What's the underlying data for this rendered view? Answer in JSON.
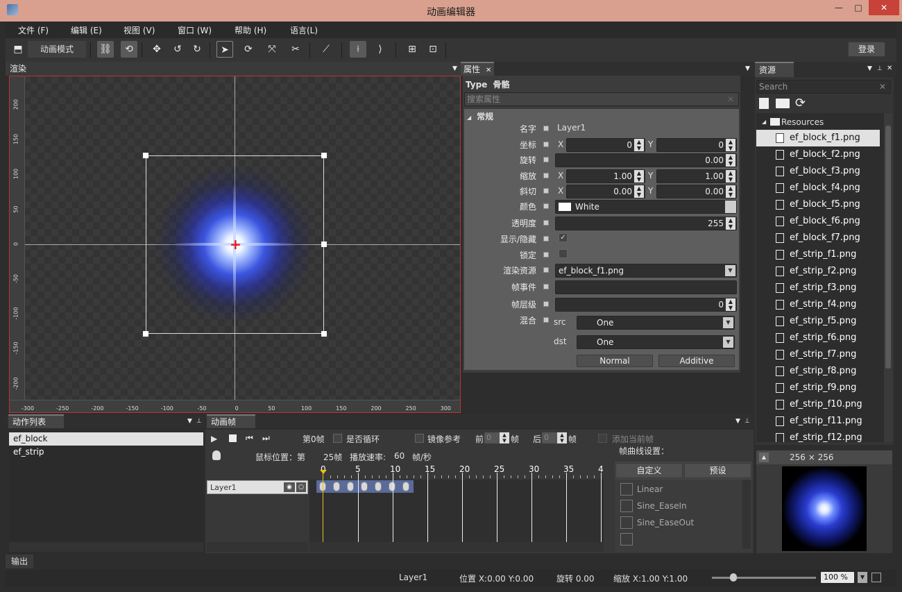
{
  "window": {
    "title": "动画编辑器"
  },
  "menu": [
    "文件 (F)",
    "编辑 (E)",
    "视图 (V)",
    "窗口 (W)",
    "帮助 (H)",
    "语言(L)"
  ],
  "toolbar": {
    "mode_label": "动画模式",
    "login_label": "登录"
  },
  "render_panel": {
    "title": "渲染"
  },
  "ruler": {
    "x_ticks": [
      "-300",
      "-250",
      "-200",
      "-150",
      "-100",
      "-50",
      "0",
      "50",
      "100",
      "150",
      "200",
      "250",
      "300"
    ],
    "y_ticks": [
      "200",
      "150",
      "100",
      "50",
      "0",
      "-50",
      "-100",
      "-150",
      "-200"
    ]
  },
  "properties": {
    "tab_label": "属性",
    "type_label": "Type",
    "type_value": "骨骼",
    "search_placeholder": "搜索属性",
    "section": "常规",
    "name_label": "名字",
    "name_value": "Layer1",
    "pos_label": "坐标",
    "pos_x": "0",
    "pos_y": "0",
    "rotation_label": "旋转",
    "rotation_value": "0.00",
    "scale_label": "缩放",
    "scale_x": "1.00",
    "scale_y": "1.00",
    "skew_label": "斜切",
    "skew_x": "0.00",
    "skew_y": "0.00",
    "color_label": "颜色",
    "color_value": "White",
    "opacity_label": "透明度",
    "opacity_value": "255",
    "visible_label": "显示/隐藏",
    "lock_label": "锁定",
    "resource_label": "渲染资源",
    "resource_value": "ef_block_f1.png",
    "frame_event_label": "帧事件",
    "frame_layer_label": "帧层级",
    "frame_layer_value": "0",
    "blend_label": "混合",
    "src_label": "src",
    "src_value": "One",
    "dst_label": "dst",
    "dst_value": "One",
    "normal_label": "Normal",
    "additive_label": "Additive",
    "x_axis": "X",
    "y_axis": "Y"
  },
  "resources": {
    "title": "资源",
    "search_placeholder": "Search",
    "folder": "Resources",
    "items": [
      "ef_block_f1.png",
      "ef_block_f2.png",
      "ef_block_f3.png",
      "ef_block_f4.png",
      "ef_block_f5.png",
      "ef_block_f6.png",
      "ef_block_f7.png",
      "ef_strip_f1.png",
      "ef_strip_f2.png",
      "ef_strip_f3.png",
      "ef_strip_f4.png",
      "ef_strip_f5.png",
      "ef_strip_f6.png",
      "ef_strip_f7.png",
      "ef_strip_f8.png",
      "ef_strip_f9.png",
      "ef_strip_f10.png",
      "ef_strip_f11.png",
      "ef_strip_f12.png"
    ],
    "preview_size": "256 × 256"
  },
  "actions": {
    "title": "动作列表",
    "items": [
      "ef_block",
      "ef_strip"
    ]
  },
  "timeline": {
    "title": "动画帧",
    "frame_label": "第0帧",
    "loop_label": "是否循环",
    "mirror_label": "镜像参考",
    "before_label": "前",
    "before_value": "0",
    "frame_unit": "帧",
    "after_label": "后",
    "after_value": "0",
    "add_current_label": "添加当前帧",
    "mouse_pos_label": "鼠标位置：第",
    "mouse_frame": "25帧",
    "play_rate_label": "播放速率:",
    "play_rate_value": "60",
    "play_rate_unit": "帧/秒",
    "curve_settings_label": "帧曲线设置：",
    "custom_tab": "自定义",
    "preset_tab": "预设",
    "ruler": [
      "0",
      "5",
      "10",
      "15",
      "20",
      "25",
      "30",
      "35",
      "4"
    ],
    "layer_name": "Layer1",
    "curves": [
      "Linear",
      "Sine_EaseIn",
      "Sine_EaseOut"
    ]
  },
  "output": {
    "title": "输出"
  },
  "status": {
    "layer": "Layer1",
    "position": "位置 X:0.00  Y:0.00",
    "rotation": "旋转 0.00",
    "scale": "缩放 X:1.00  Y:1.00",
    "zoom": "100 %"
  },
  "colors": {
    "titlebar": "#d9a08f",
    "accent_red": "#e21b1b",
    "timeline_cursor": "#e8c21a"
  }
}
